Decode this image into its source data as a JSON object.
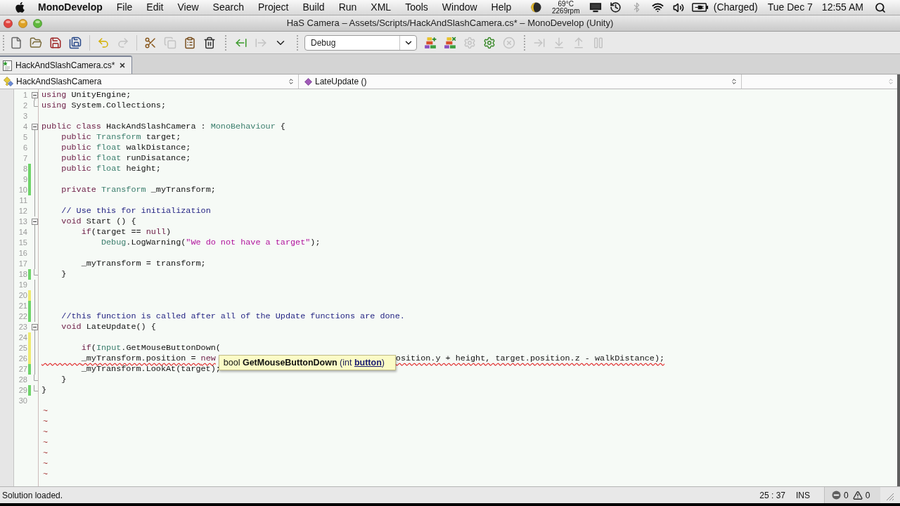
{
  "menu_bar": {
    "app_name": "MonoDevelop",
    "menus": [
      "File",
      "Edit",
      "View",
      "Search",
      "Project",
      "Build",
      "Run",
      "XML",
      "Tools",
      "Window",
      "Help"
    ],
    "extras": {
      "temperature": "69°C",
      "fan_speed": "2269rpm",
      "battery_status": "(Charged)",
      "date": "Tue Dec 7",
      "time": "12:55 AM"
    }
  },
  "window": {
    "title": "HaS Camera – Assets/Scripts/HackAndSlashCamera.cs* – MonoDevelop (Unity)"
  },
  "toolbar": {
    "left_groups": [
      {
        "buttons": [
          {
            "disabled": false
          },
          {
            "disabled": false
          },
          {
            "disabled": false
          },
          {
            "disabled": false
          }
        ]
      },
      {
        "buttons": [
          {
            "disabled": false
          },
          {
            "disabled": true
          }
        ]
      },
      {
        "buttons": [
          {
            "disabled": false
          },
          {
            "disabled": true
          },
          {
            "disabled": false
          },
          {
            "disabled": false
          }
        ]
      },
      {
        "buttons": [
          {
            "disabled": false
          },
          {
            "disabled": true
          },
          {
            "disabled": false
          }
        ]
      }
    ],
    "configuration": "Debug",
    "right_groups": [
      {
        "buttons": [
          {
            "disabled": false
          },
          {
            "disabled": false
          },
          {
            "disabled": true
          },
          {
            "disabled": false
          },
          {
            "disabled": true
          }
        ]
      },
      {
        "buttons": [
          {
            "disabled": true
          },
          {
            "disabled": true
          },
          {
            "disabled": true
          },
          {
            "disabled": true
          }
        ]
      }
    ]
  },
  "tabs": [
    {
      "label": "HackAndSlashCamera.cs*",
      "selected": true
    }
  ],
  "navigation": {
    "class": "HackAndSlashCamera",
    "member": "LateUpdate ()"
  },
  "editor": {
    "lines": [
      {
        "number": "1",
        "fold_start": true,
        "fold_end": false,
        "error": false,
        "tokens": [
          {
            "kind": "keyword",
            "text": "using"
          },
          {
            "kind": "plain",
            "text": " UnityEngine;"
          }
        ]
      },
      {
        "number": "2",
        "fold_start": false,
        "fold_end": true,
        "error": false,
        "tokens": [
          {
            "kind": "keyword",
            "text": "using"
          },
          {
            "kind": "plain",
            "text": " System.Collections;"
          }
        ]
      },
      {
        "number": "3",
        "fold_start": false,
        "fold_end": false,
        "error": false
      },
      {
        "number": "4",
        "fold_start": true,
        "fold_end": false,
        "error": false,
        "tokens": [
          {
            "kind": "keyword",
            "text": "public class"
          },
          {
            "kind": "plain",
            "text": " HackAndSlashCamera : "
          },
          {
            "kind": "type",
            "text": "MonoBehaviour"
          },
          {
            "kind": "plain",
            "text": " {"
          }
        ]
      },
      {
        "number": "5",
        "fold_start": false,
        "fold_end": false,
        "error": false,
        "tokens": [
          {
            "kind": "keyword",
            "text": "    public"
          },
          {
            "kind": "type",
            "text": " Transform"
          },
          {
            "kind": "plain",
            "text": " target;"
          }
        ]
      },
      {
        "number": "6",
        "fold_start": false,
        "fold_end": false,
        "error": false,
        "tokens": [
          {
            "kind": "keyword",
            "text": "    public"
          },
          {
            "kind": "type",
            "text": " float"
          },
          {
            "kind": "plain",
            "text": " walkDistance;"
          }
        ]
      },
      {
        "number": "7",
        "fold_start": false,
        "fold_end": false,
        "error": false,
        "tokens": [
          {
            "kind": "keyword",
            "text": "    public"
          },
          {
            "kind": "type",
            "text": " float"
          },
          {
            "kind": "plain",
            "text": " runDisatance;"
          }
        ]
      },
      {
        "number": "8",
        "color": "#6fd46a",
        "fold_start": false,
        "fold_end": false,
        "error": false,
        "tokens": [
          {
            "kind": "keyword",
            "text": "    public"
          },
          {
            "kind": "type",
            "text": " float"
          },
          {
            "kind": "plain",
            "text": " height;"
          }
        ]
      },
      {
        "number": "9",
        "color": "#6fd46a",
        "fold_start": false,
        "fold_end": false,
        "error": false
      },
      {
        "number": "10",
        "color": "#6fd46a",
        "fold_start": false,
        "fold_end": false,
        "error": false,
        "tokens": [
          {
            "kind": "keyword",
            "text": "    private"
          },
          {
            "kind": "type",
            "text": " Transform"
          },
          {
            "kind": "plain",
            "text": " _myTransform;"
          }
        ]
      },
      {
        "number": "11",
        "fold_start": false,
        "fold_end": false,
        "error": false
      },
      {
        "number": "12",
        "fold_start": false,
        "fold_end": false,
        "error": false,
        "tokens": [
          {
            "kind": "comment",
            "text": "    // Use this for initialization"
          }
        ]
      },
      {
        "number": "13",
        "fold_start": true,
        "fold_end": false,
        "error": false,
        "tokens": [
          {
            "kind": "keyword",
            "text": "    void"
          },
          {
            "kind": "plain",
            "text": " Start () {"
          }
        ]
      },
      {
        "number": "14",
        "fold_start": false,
        "fold_end": false,
        "error": false,
        "tokens": [
          {
            "kind": "keyword",
            "text": "        if"
          },
          {
            "kind": "plain",
            "text": "(target == "
          },
          {
            "kind": "keyword",
            "text": "null"
          },
          {
            "kind": "plain",
            "text": ")"
          }
        ]
      },
      {
        "number": "15",
        "fold_start": false,
        "fold_end": false,
        "error": false,
        "tokens": [
          {
            "kind": "type",
            "text": "            Debug"
          },
          {
            "kind": "plain",
            "text": ".LogWarning("
          },
          {
            "kind": "string",
            "text": "\"We do not have a target\""
          },
          {
            "kind": "plain",
            "text": ");"
          }
        ]
      },
      {
        "number": "16",
        "fold_start": false,
        "fold_end": false,
        "error": false
      },
      {
        "number": "17",
        "fold_start": false,
        "fold_end": false,
        "error": false,
        "tokens": [
          {
            "kind": "plain",
            "text": "        _myTransform = transform;"
          }
        ]
      },
      {
        "number": "18",
        "color": "#6fd46a",
        "fold_start": false,
        "fold_end": true,
        "error": false,
        "tokens": [
          {
            "kind": "plain",
            "text": "    }"
          }
        ]
      },
      {
        "number": "19",
        "fold_start": false,
        "fold_end": false,
        "error": false
      },
      {
        "number": "20",
        "color": "#eeea70",
        "fold_start": false,
        "fold_end": false,
        "error": false
      },
      {
        "number": "21",
        "color": "#6fd46a",
        "fold_start": false,
        "fold_end": false,
        "error": false
      },
      {
        "number": "22",
        "color": "#6fd46a",
        "fold_start": false,
        "fold_end": false,
        "error": false,
        "tokens": [
          {
            "kind": "comment",
            "text": "    //this function is called after all of the Update functions are done."
          }
        ]
      },
      {
        "number": "23",
        "fold_start": true,
        "fold_end": false,
        "error": false,
        "tokens": [
          {
            "kind": "keyword",
            "text": "    void"
          },
          {
            "kind": "plain",
            "text": " LateUpdate() {"
          }
        ]
      },
      {
        "number": "24",
        "color": "#eeea70",
        "fold_start": false,
        "fold_end": false,
        "error": false
      },
      {
        "number": "25",
        "color": "#eeea70",
        "fold_start": false,
        "fold_end": false,
        "error": false,
        "tokens": [
          {
            "kind": "keyword",
            "text": "        if"
          },
          {
            "kind": "plain",
            "text": "("
          },
          {
            "kind": "type",
            "text": "Input"
          },
          {
            "kind": "plain",
            "text": ".GetMouseButtonDown("
          }
        ]
      },
      {
        "number": "26",
        "color": "#eeea70",
        "fold_start": false,
        "fold_end": false,
        "error": true,
        "tokens": [
          {
            "kind": "plain",
            "text": "        _myTransform.position = "
          },
          {
            "kind": "keyword",
            "text": "new"
          },
          {
            "kind": "tooltip",
            "parts": [
              {
                "kind": "plain",
                "text": "bool "
              },
              {
                "kind": "bold",
                "text": "GetMouseButtonDown"
              },
              {
                "kind": "param",
                "text": " (int "
              },
              {
                "kind": "current-param",
                "text": "button"
              },
              {
                "kind": "param",
                "text": ")"
              }
            ]
          },
          {
            "kind": "plain",
            "text": "osition.y + height, target.position.z - walkDistance);"
          }
        ]
      },
      {
        "number": "27",
        "color": "#6fd46a",
        "fold_start": false,
        "fold_end": false,
        "error": false,
        "tokens": [
          {
            "kind": "plain",
            "text": "        _myTransform.LookAt(target);"
          }
        ]
      },
      {
        "number": "28",
        "fold_start": false,
        "fold_end": true,
        "error": false,
        "tokens": [
          {
            "kind": "plain",
            "text": "    }"
          }
        ]
      },
      {
        "number": "29",
        "color": "#6fd46a",
        "fold_start": false,
        "fold_end": true,
        "error": false,
        "tokens": [
          {
            "kind": "plain",
            "text": "}"
          }
        ]
      },
      {
        "number": "30",
        "fold_start": false,
        "fold_end": false,
        "error": false
      }
    ],
    "end_markers": [
      "~",
      "~",
      "~",
      "~",
      "~",
      "~",
      "~"
    ]
  },
  "status_bar": {
    "message": "Solution loaded.",
    "position": "25 : 37",
    "mode": "INS",
    "errors": "0",
    "warnings": "0"
  }
}
